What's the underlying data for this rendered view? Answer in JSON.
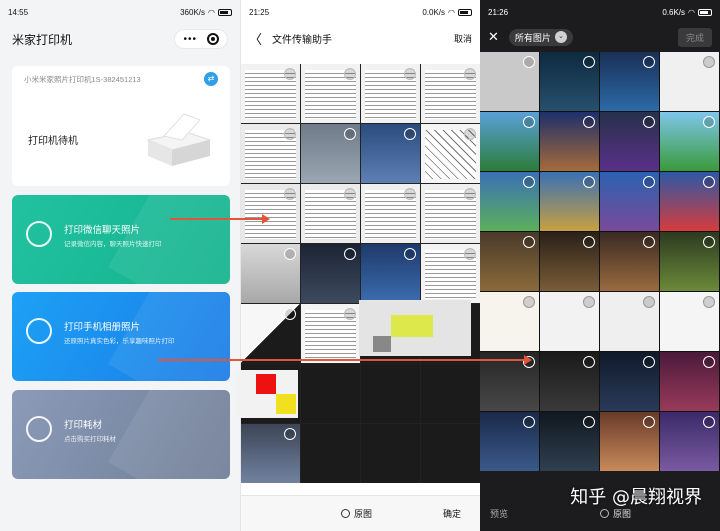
{
  "panel1": {
    "status": {
      "time": "14:55",
      "speed": "360K/s",
      "battery": ""
    },
    "app_title": "米家打印机",
    "capsule_more": "•••",
    "printer_model": "小米米家照片打印机1S-382451213",
    "switch_icon": "⇄",
    "printer_status": "打印机待机",
    "actions": [
      {
        "title": "打印微信聊天照片",
        "subtitle": "记录微信内容，聊天照片快速打印",
        "icon": "chat-icon"
      },
      {
        "title": "打印手机相册照片",
        "subtitle": "还原照片真实色彩，乐享趣味照片打印",
        "icon": "image-icon"
      },
      {
        "title": "打印耗材",
        "subtitle": "点击购买打印耗材",
        "icon": "drop-icon"
      }
    ]
  },
  "panel2": {
    "status": {
      "time": "21:25",
      "speed": "0.0K/s"
    },
    "back": "〈",
    "title": "文件传输助手",
    "cancel": "取消",
    "original": "原图",
    "confirm": "确定"
  },
  "panel3": {
    "status": {
      "time": "21:26",
      "speed": "0.6K/s"
    },
    "close": "✕",
    "album": "所有图片",
    "album_chevron": "⌄",
    "done": "完成",
    "preview": "预览",
    "original": "原图"
  },
  "watermark": "知乎 @晨翔视界",
  "colors": {
    "wechat_green": "#13b38e",
    "album_blue": "#1a7be6",
    "supplies_gray": "#7a89a3",
    "arrow_red": "#e2553a"
  }
}
